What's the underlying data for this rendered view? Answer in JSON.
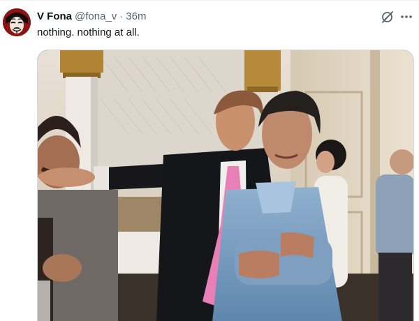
{
  "tweet": {
    "author_name": "V Fona",
    "author_handle": "@fona_v",
    "separator": "·",
    "time": "36m",
    "text": "nothing. nothing at all."
  },
  "icons": {
    "avatar": "avatar-mask-icon",
    "grok": "grok-icon",
    "more": "more-horizontal-icon"
  },
  "colors": {
    "text_primary": "#0f1419",
    "text_secondary": "#536471",
    "border": "#cfd9de"
  }
}
